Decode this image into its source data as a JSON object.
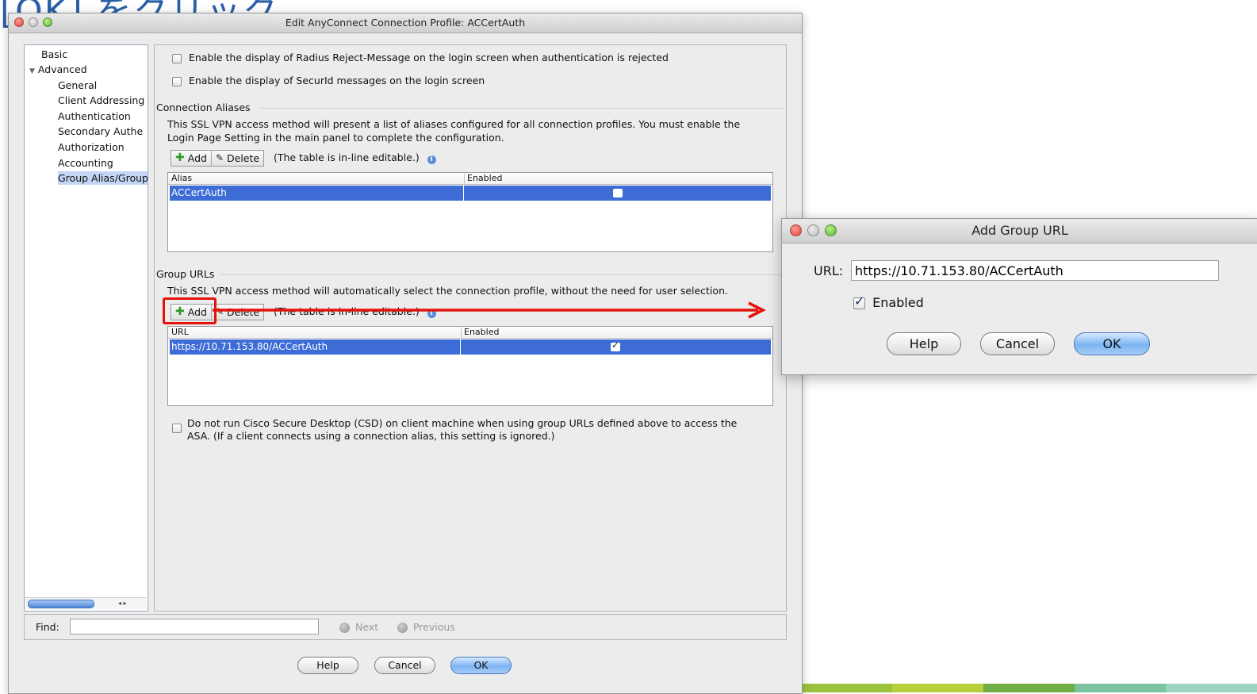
{
  "slide": {
    "heading": "[OK] をクリック"
  },
  "main_window": {
    "title": "Edit AnyConnect Connection Profile: ACCertAuth",
    "nav": {
      "items": [
        {
          "label": "Basic",
          "level": 0,
          "selected": false
        },
        {
          "label": "Advanced",
          "level": 0,
          "expanded": true,
          "selected": false
        },
        {
          "label": "General",
          "level": 1,
          "selected": false
        },
        {
          "label": "Client Addressing",
          "level": 1,
          "selected": false
        },
        {
          "label": "Authentication",
          "level": 1,
          "selected": false
        },
        {
          "label": "Secondary Authe",
          "level": 1,
          "selected": false
        },
        {
          "label": "Authorization",
          "level": 1,
          "selected": false
        },
        {
          "label": "Accounting",
          "level": 1,
          "selected": false
        },
        {
          "label": "Group Alias/Group URL",
          "level": 1,
          "selected": true
        }
      ],
      "scroll_arrows": "◂ ▸"
    },
    "options": {
      "radius_reject": {
        "label": "Enable the display of Radius Reject-Message on the login screen when authentication is rejected",
        "checked": false
      },
      "securid": {
        "label": "Enable the display of SecurId messages on the login screen",
        "checked": false
      }
    },
    "aliases": {
      "section_title": "Connection Aliases",
      "description_line1": "This SSL VPN access method will present a list of aliases configured for all connection profiles. You must enable the",
      "description_line2": "Login Page Setting in the main panel to complete the configuration.",
      "add_label": "Add",
      "delete_label": "Delete",
      "note": "(The table is in-line editable.)",
      "columns": [
        "Alias",
        "Enabled"
      ],
      "rows": [
        {
          "alias": "ACCertAuth",
          "enabled": false
        }
      ]
    },
    "group_urls": {
      "section_title": "Group URLs",
      "description": "This SSL VPN access method will automatically select the connection profile, without the need for user selection.",
      "add_label": "Add",
      "delete_label": "Delete",
      "note": "(The table is in-line editable.)",
      "columns": [
        "URL",
        "Enabled"
      ],
      "rows": [
        {
          "url": "https://10.71.153.80/ACCertAuth",
          "enabled": true
        }
      ]
    },
    "csd_option": {
      "label_line1": "Do not run Cisco Secure Desktop (CSD) on client machine when using group URLs defined above to access the",
      "label_line2": "ASA. (If a client connects using a connection alias, this setting is ignored.)",
      "checked": false
    },
    "find": {
      "label": "Find:",
      "value": "",
      "next_label": "Next",
      "previous_label": "Previous"
    },
    "buttons": {
      "help": "Help",
      "cancel": "Cancel",
      "ok": "OK"
    }
  },
  "dialog": {
    "title": "Add Group URL",
    "url_label": "URL:",
    "url_value": "https://10.71.153.80/ACCertAuth",
    "enabled_label": "Enabled",
    "enabled_checked": true,
    "buttons": {
      "help": "Help",
      "cancel": "Cancel",
      "ok": "OK"
    }
  },
  "colors": {
    "selection_blue": "#3e6cd6",
    "annotation_red": "#e3120b",
    "heading_blue": "#2a5fa8"
  }
}
